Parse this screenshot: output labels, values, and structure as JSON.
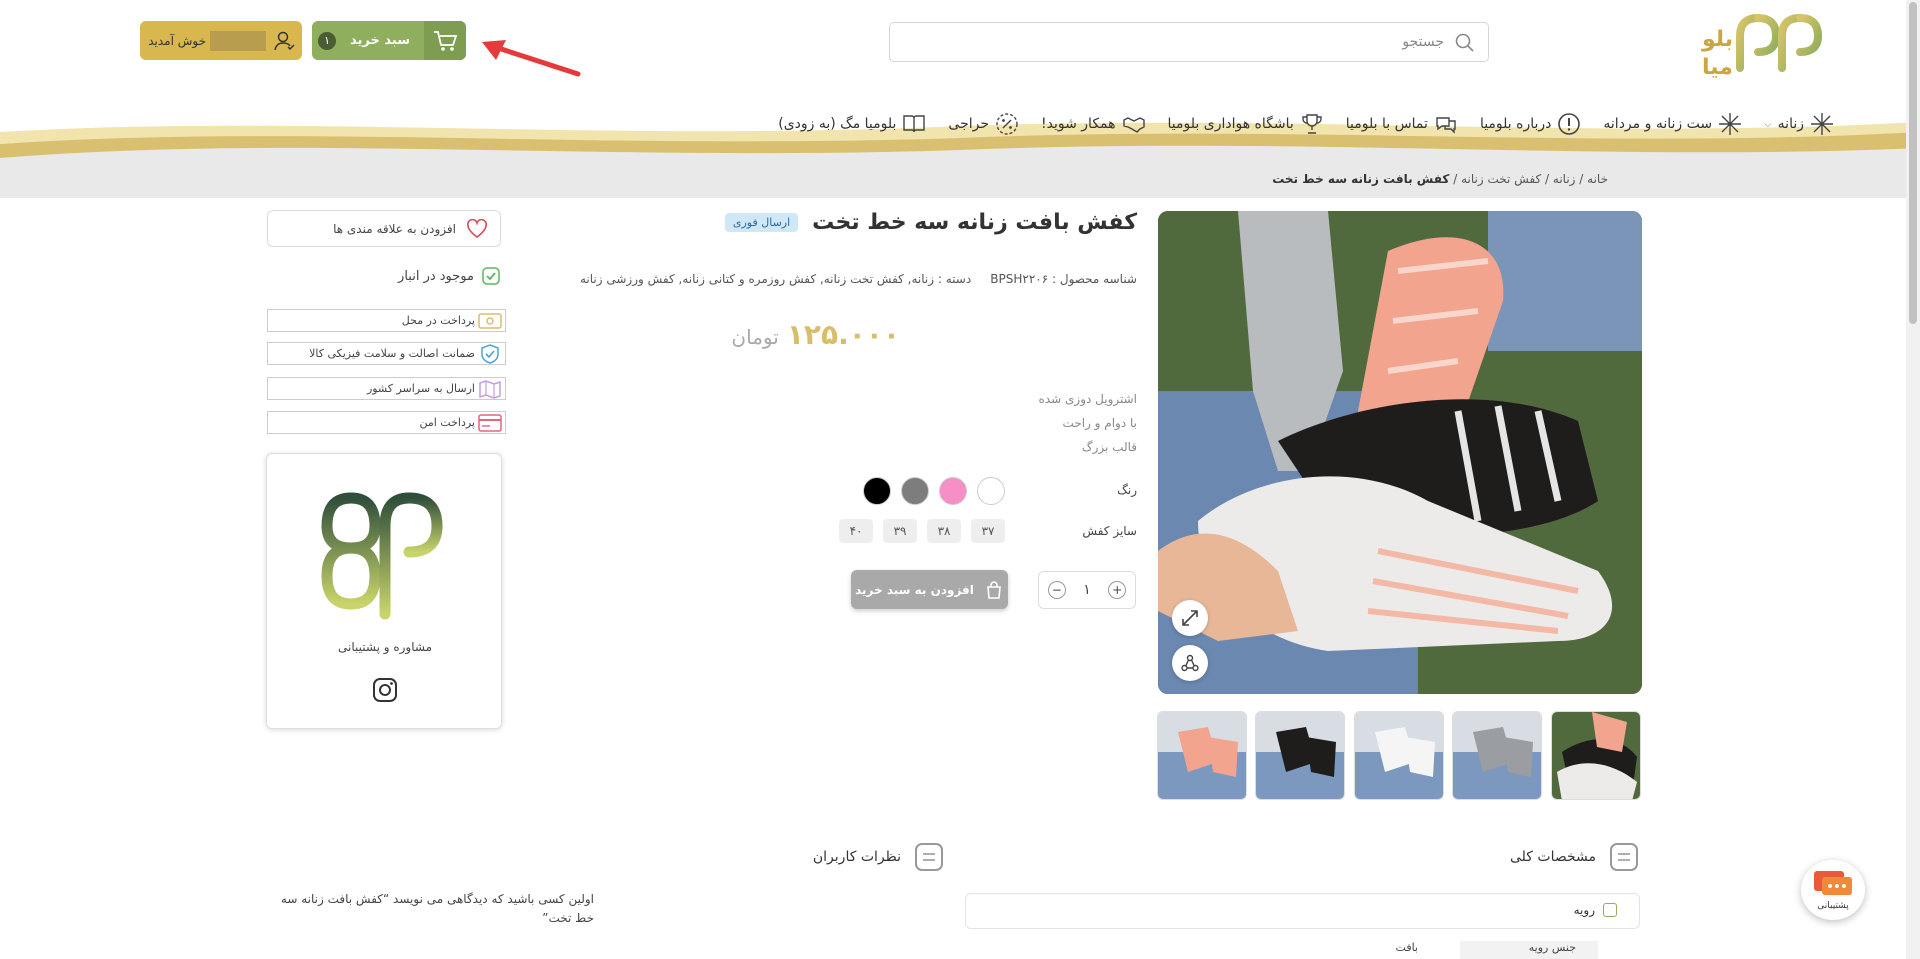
{
  "header": {
    "logo_text": "بلو میا",
    "search": {
      "placeholder": "جستجو"
    },
    "cart": {
      "label": "سبد خرید",
      "count": "۱"
    },
    "user": {
      "greeting": "خوش آمدید"
    }
  },
  "nav": {
    "items": [
      {
        "label": "زنانه",
        "icon": "sparkle-icon"
      },
      {
        "label": "ست زنانه و مردانه",
        "icon": "sparkle-icon"
      },
      {
        "label": "درباره بلومیا",
        "icon": "exclamation-icon"
      },
      {
        "label": "تماس با بلومیا",
        "icon": "chat-bubbles-icon"
      },
      {
        "label": "باشگاه هواداری بلومیا",
        "icon": "trophy-icon"
      },
      {
        "label": "همکار شوید!",
        "icon": "handshake-icon"
      },
      {
        "label": "حراجی",
        "icon": "percent-badge-icon"
      },
      {
        "label": "بلومیا مگ (به زودی)",
        "icon": "book-icon"
      }
    ]
  },
  "breadcrumb": {
    "home": "خانه",
    "l1": "زنانه",
    "l2": "کفش تخت زنانه",
    "current": "کفش بافت زنانه سه خط تخت",
    "sep": " / "
  },
  "product": {
    "title": "کفش بافت زنانه سه خط تخت",
    "badge": "ارسال فوری",
    "sku_label": "شناسه محصول :",
    "sku": "BPSH۲۲۰۶",
    "category_label": "دسته :",
    "categories": "زنانه, کفش تخت زنانه, کفش روزمره و کتانی زنانه, کفش ورزشی زنانه",
    "price": "۱۲۵.۰۰۰",
    "currency": "تومان",
    "features": [
      "اشترویل دوزی شده",
      "با دوام و راحت",
      "قالب بزرگ"
    ],
    "color_label": "رنگ",
    "colors": [
      "#ffffff",
      "#f58fc6",
      "#7d7d7d",
      "#000000"
    ],
    "size_label": "سایز کفش",
    "sizes": [
      "۳۷",
      "۳۸",
      "۳۹",
      "۴۰"
    ],
    "qty": "۱",
    "add_to_cart": "افزودن به سبد خرید"
  },
  "sidebar": {
    "wishlist": "افزودن به علاقه مندی ها",
    "stock": "موجود در انبار",
    "guarantees": [
      {
        "label": "پرداخت در محل",
        "icon": "cash-icon"
      },
      {
        "label": "ضمانت اصالت و سلامت فیزیکی کالا",
        "icon": "shield-check-icon"
      },
      {
        "label": "ارسال به سراسر کشور",
        "icon": "map-icon"
      },
      {
        "label": "پرداخت امن",
        "icon": "credit-card-icon"
      }
    ],
    "support_label": "مشاوره و پشتیبانی"
  },
  "tabs": {
    "specs": "مشخصات کلی",
    "comments": "نظرات کاربران",
    "spec_group": "رویه",
    "spec_key": "جنس رویه",
    "spec_value": "بافت",
    "review_note": "اولین کسی باشید که دیدگاهی می نویسد “کفش بافت زنانه سه خط تخت”"
  },
  "chat": {
    "label": "پشتیبانی"
  },
  "colors": {
    "accent_green": "#8fae5e",
    "accent_gold": "#d8b74f",
    "price": "#d9bd6b"
  }
}
